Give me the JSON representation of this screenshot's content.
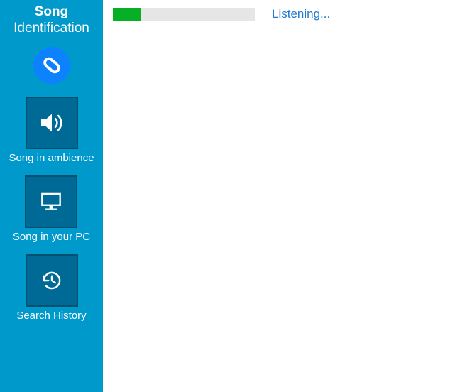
{
  "sidebar": {
    "title_line1": "Song",
    "title_line2": "Identification",
    "items": [
      {
        "id": "ambience",
        "label": "Song in ambience",
        "icon": "speaker-icon"
      },
      {
        "id": "pc",
        "label": "Song in your PC",
        "icon": "monitor-icon"
      },
      {
        "id": "history",
        "label": "Search History",
        "icon": "history-icon"
      }
    ]
  },
  "main": {
    "progress_percent": 20,
    "status_text": "Listening..."
  },
  "colors": {
    "sidebar_bg": "#0099cc",
    "tile_bg": "#006a97",
    "logo_bg": "#0d82ff",
    "progress_fill": "#06b025",
    "status_text": "#1d7ccd"
  }
}
